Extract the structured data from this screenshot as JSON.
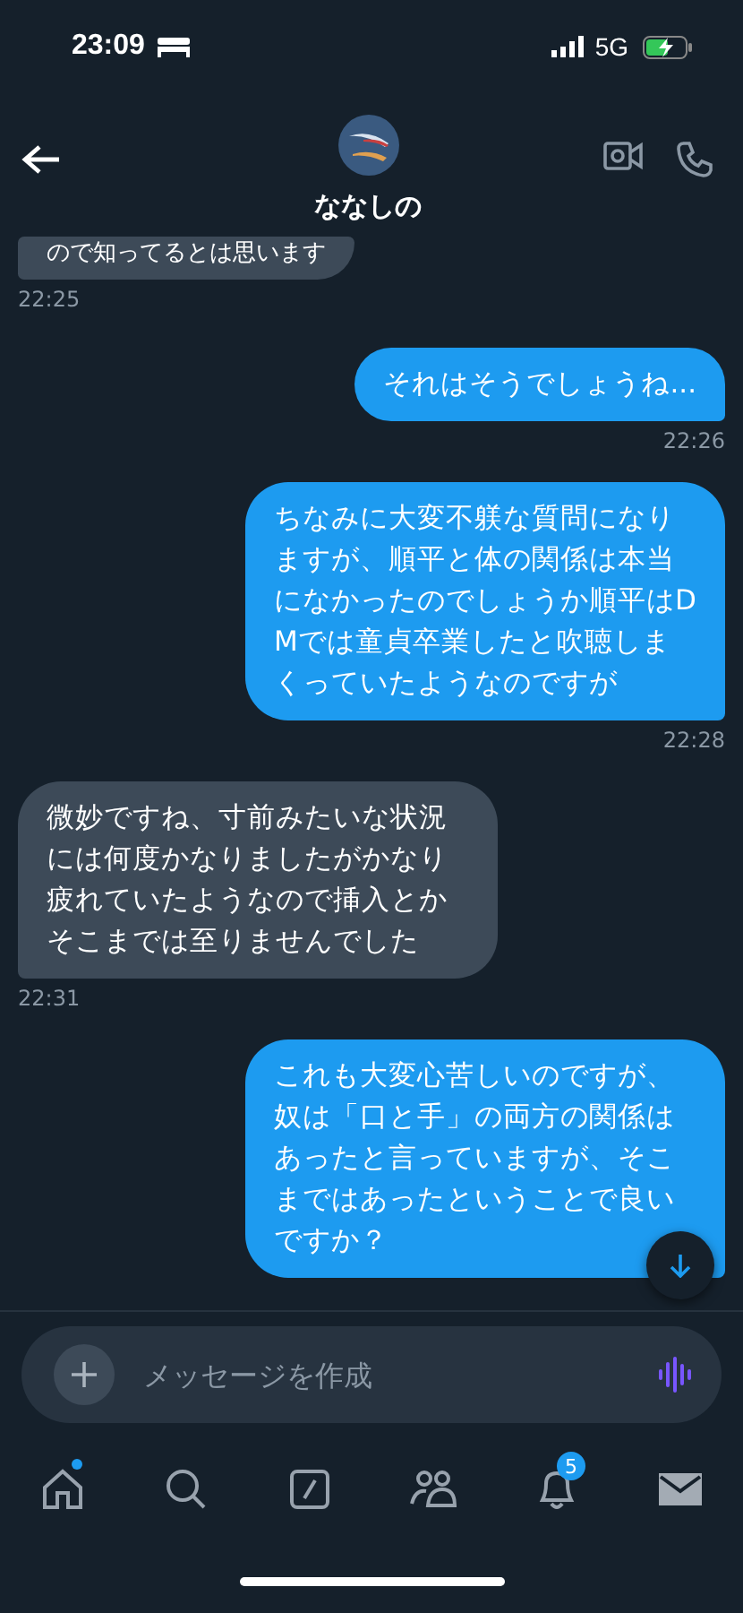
{
  "status_bar": {
    "time": "23:09",
    "network": "5G"
  },
  "header": {
    "name": "ななしの"
  },
  "messages": [
    {
      "kind": "received",
      "text": "ので知ってるとは思います",
      "time": "22:25"
    },
    {
      "kind": "sent",
      "text": "それはそうでしょうね...",
      "time": "22:26"
    },
    {
      "kind": "sent",
      "text": "ちなみに大変不躾な質問になりますが、順平と体の関係は本当になかったのでしょうか順平はDMでは童貞卒業したと吹聴しまくっていたようなのですが",
      "time": "22:28"
    },
    {
      "kind": "received",
      "text": "微妙ですね、寸前みたいな状況には何度かなりましたがかなり疲れていたようなので挿入とかそこまでは至りませんでした",
      "time": "22:31"
    },
    {
      "kind": "sent",
      "text": "これも大変心苦しいのですが、奴は「口と手」の両方の関係はあったと言っていますが、そこまではあったということで良いですか？"
    }
  ],
  "composer": {
    "placeholder": "メッセージを作成"
  },
  "nav": [
    {
      "kind": "home",
      "selected": false,
      "dot": true
    },
    {
      "kind": "search",
      "selected": false,
      "dot": false
    },
    {
      "kind": "grok",
      "selected": false,
      "dot": false
    },
    {
      "kind": "communities",
      "selected": false,
      "dot": false
    },
    {
      "kind": "notifications",
      "selected": false,
      "dot": false,
      "badge": "5"
    },
    {
      "kind": "messages",
      "selected": true,
      "dot": false
    }
  ]
}
